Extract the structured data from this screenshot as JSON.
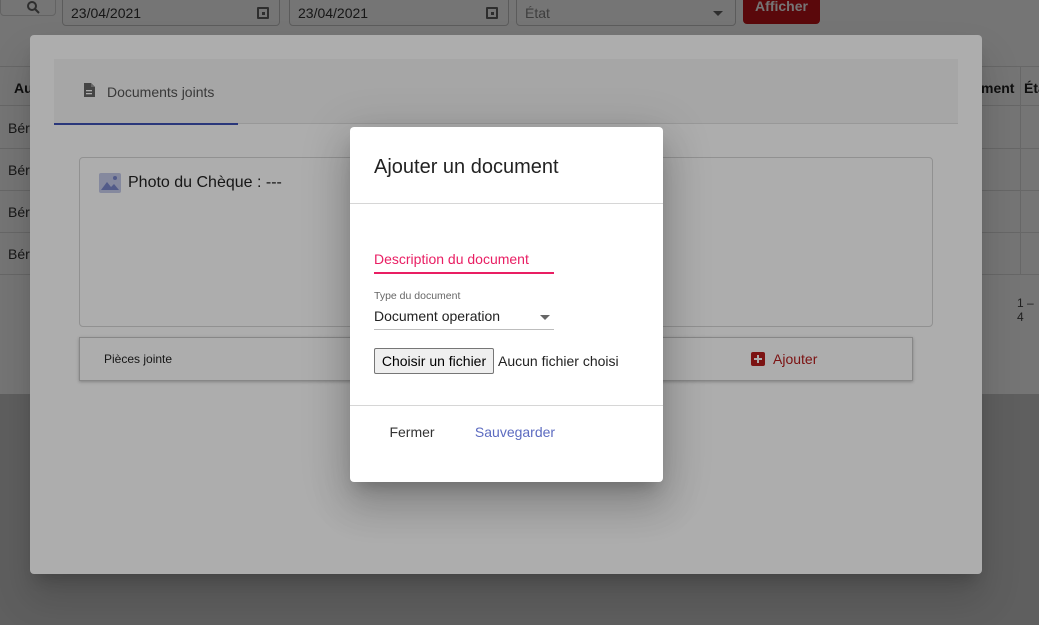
{
  "toolbar": {
    "date_from": "23/04/2021",
    "date_to": "23/04/2021",
    "state_placeholder": "État",
    "show_button": "Afficher"
  },
  "table": {
    "headers": {
      "first": "Au",
      "document": "ment",
      "state": "Éta"
    },
    "rows": [
      "Bér",
      "Bér",
      "Bér",
      "Bér"
    ],
    "pager": "1 – 4"
  },
  "documents_dialog": {
    "tab_label": "Documents joints",
    "photo_label": "Photo du Chèque : ---",
    "attachments_label": "Pièces jointe",
    "add_button": "Ajouter"
  },
  "add_document_dialog": {
    "title": "Ajouter un document",
    "description_label": "Description du document",
    "type_caption": "Type du document",
    "type_value": "Document operation",
    "file_button": "Choisir un fichier",
    "file_status": "Aucun fichier choisi",
    "close_button": "Fermer",
    "save_button": "Sauvegarder"
  },
  "colors": {
    "accent_red": "#c4141a",
    "tab_indicator": "#3f51b5",
    "field_focus": "#e91e63",
    "save_text": "#5c6bc0"
  }
}
